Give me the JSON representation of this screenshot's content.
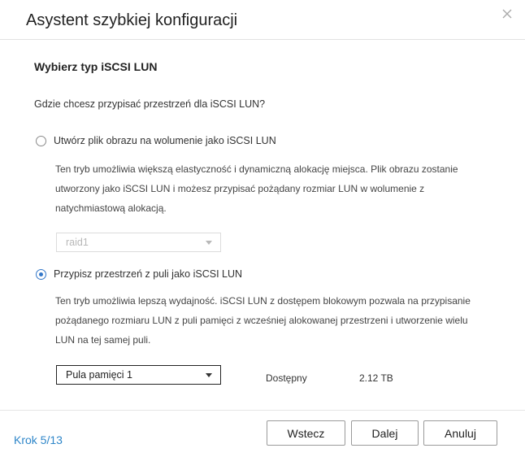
{
  "dialog": {
    "title": "Asystent szybkiej konfiguracji",
    "close_icon": "close-icon"
  },
  "content": {
    "section_title": "Wybierz typ iSCSI LUN",
    "question": "Gdzie chcesz przypisać przestrzeń dla iSCSI LUN?",
    "option_file": {
      "label": "Utwórz plik obrazu na wolumenie jako iSCSI LUN",
      "selected": false,
      "description_lines": [
        "Ten tryb umożliwia większą elastyczność i dynamiczną alokację miejsca. Plik obrazu zostanie",
        "utworzony jako iSCSI LUN i możesz przypisać pożądany rozmiar LUN w wolumenie z",
        "natychmiastową alokacją."
      ],
      "volume_select": {
        "value": "raid1",
        "disabled": true
      }
    },
    "option_pool": {
      "label": "Przypisz przestrzeń z puli jako iSCSI LUN",
      "selected": true,
      "description_lines": [
        "Ten tryb umożliwia lepszą wydajność. iSCSI LUN z dostępem blokowym pozwala na przypisanie",
        "pożądanego rozmiaru LUN z puli pamięci z wcześniej alokowanej przestrzeni i utworzenie wielu",
        "LUN na tej samej puli."
      ],
      "pool_select": {
        "value": "Pula pamięci 1",
        "disabled": false
      },
      "available_label": "Dostępny",
      "available_value": "2.12 TB"
    }
  },
  "footer": {
    "step": "Krok 5/13",
    "back_label": "Wstecz",
    "next_label": "Dalej",
    "cancel_label": "Anuluj"
  },
  "colors": {
    "accent": "#3478c9",
    "step_text": "#2e86c9"
  }
}
